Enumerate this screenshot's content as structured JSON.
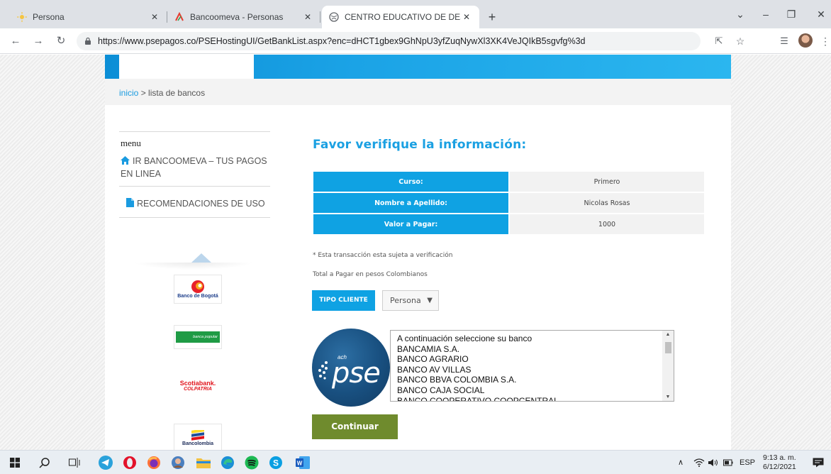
{
  "browser": {
    "tabs": [
      {
        "title": "Persona",
        "active": false
      },
      {
        "title": "Bancoomeva - Personas",
        "active": false
      },
      {
        "title": "CENTRO EDUCATIVO DE DESARR",
        "active": true
      }
    ],
    "close_glyph": "✕",
    "new_tab_glyph": "+",
    "url": "https://www.psepagos.co/PSEHostingUI/GetBankList.aspx?enc=dHCT1gbex9GhNpU3yfZuqNywXl3XK4VeJQIkB5sgvfg%3d"
  },
  "page": {
    "breadcrumb": {
      "home": "inicio",
      "separator": " > ",
      "current": "lista de bancos"
    },
    "sidebar": {
      "menu_title": "menu",
      "items": [
        {
          "label": "IR BANCOOMEVA – TUS PAGOS EN LINEA",
          "icon": "home-icon"
        },
        {
          "label": "RECOMENDACIONES DE USO",
          "icon": "document-icon"
        }
      ],
      "bank_logos": [
        {
          "name": "Banco de Bogotá"
        },
        {
          "name": "banca popular"
        },
        {
          "name": "Scotiabank.",
          "name2": "COLPATRIA"
        },
        {
          "name": "Bancolombia"
        }
      ]
    },
    "main": {
      "heading": "Favor verifique la información:",
      "info_rows": [
        {
          "label": "Curso:",
          "value": "Primero"
        },
        {
          "label": "Nombre a Apellido:",
          "value": "Nicolas Rosas"
        },
        {
          "label": "Valor a Pagar:",
          "value": "1000"
        }
      ],
      "verification_note": "* Esta transacción esta sujeta a verificación",
      "total_note": "Total a Pagar en pesos Colombianos",
      "tipo_cliente_label": "TIPO CLIENTE",
      "tipo_cliente_selected": "Persona",
      "pse_logo": {
        "ach": "ach",
        "pse": "pse"
      },
      "bank_options": [
        "A continuación seleccione su banco",
        "BANCAMIA S.A.",
        "BANCO AGRARIO",
        "BANCO AV VILLAS",
        "BANCO BBVA COLOMBIA S.A.",
        "BANCO CAJA SOCIAL",
        "BANCO COOPERATIVO COOPCENTRAL"
      ],
      "continue_label": "Continuar"
    }
  },
  "taskbar": {
    "tray_lang": "ESP",
    "time": "9:13 a. m.",
    "date": "6/12/2021"
  },
  "colors": {
    "accent": "#0fa2e3",
    "heading": "#1aa0e2",
    "continue_button": "#6f8b2d"
  }
}
